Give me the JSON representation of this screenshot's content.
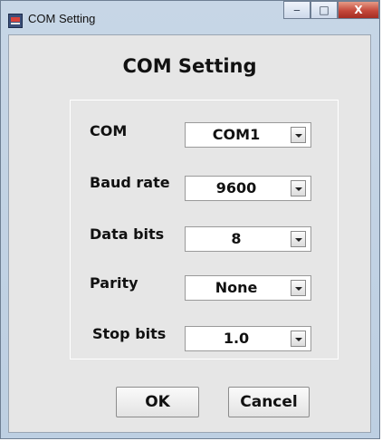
{
  "window": {
    "title": "COM Setting",
    "controls": {
      "minimize_icon": "‒",
      "maximize_icon": "□",
      "close_icon": "X"
    }
  },
  "dialog": {
    "heading": "COM Setting",
    "fields": [
      {
        "label": "COM",
        "value": "COM1"
      },
      {
        "label": "Baud rate",
        "value": "9600"
      },
      {
        "label": "Data bits",
        "value": "8"
      },
      {
        "label": "Parity",
        "value": "None"
      },
      {
        "label": "Stop bits",
        "value": "1.0"
      }
    ]
  },
  "buttons": {
    "ok_label": "OK",
    "cancel_label": "Cancel"
  },
  "colors": {
    "client_bg": "#e6e6e6",
    "frame": "#c7d6e6",
    "close_button": "#c4483b"
  }
}
